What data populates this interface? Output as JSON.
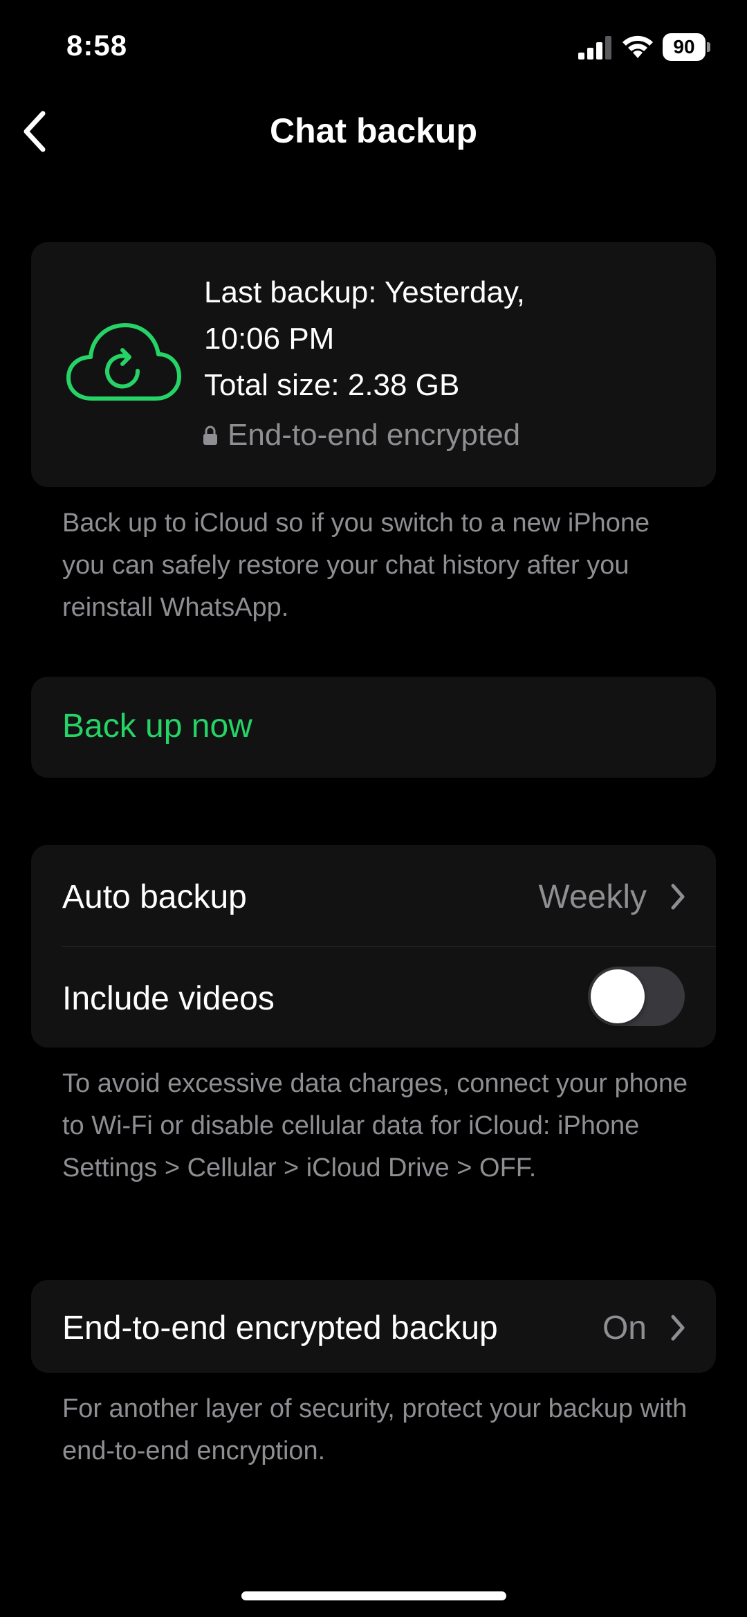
{
  "status_bar": {
    "time": "8:58",
    "battery_level": "90",
    "icons": [
      "signal-icon",
      "wifi-icon",
      "battery-icon"
    ]
  },
  "nav": {
    "back_icon": "chevron-left-icon",
    "title": "Chat backup"
  },
  "backup_info": {
    "icon": "cloud-sync-icon",
    "last_backup_line1": "Last backup: Yesterday,",
    "last_backup_line2": "10:06 PM",
    "total_size": "Total size: 2.38 GB",
    "encryption_status": "End-to-end encrypted"
  },
  "icloud_note": "Back up to iCloud so if you switch to a new iPhone you can safely restore your chat history after you reinstall WhatsApp.",
  "back_up_now_label": "Back up now",
  "settings": {
    "auto_backup": {
      "label": "Auto backup",
      "value": "Weekly"
    },
    "include_videos": {
      "label": "Include videos",
      "enabled": false
    }
  },
  "data_charges_note": "To avoid excessive data charges, connect your phone to Wi-Fi or disable cellular data for iCloud: iPhone Settings > Cellular > iCloud Drive > OFF.",
  "e2e_backup": {
    "label": "End-to-end encrypted backup",
    "value": "On"
  },
  "e2e_note": "For another layer of security, protect your backup with end-to-end encryption.",
  "colors": {
    "accent": "#25d366",
    "background": "#000000",
    "card": "#121212",
    "secondary_text": "#8e8e93",
    "toggle_off": "#39393d"
  }
}
